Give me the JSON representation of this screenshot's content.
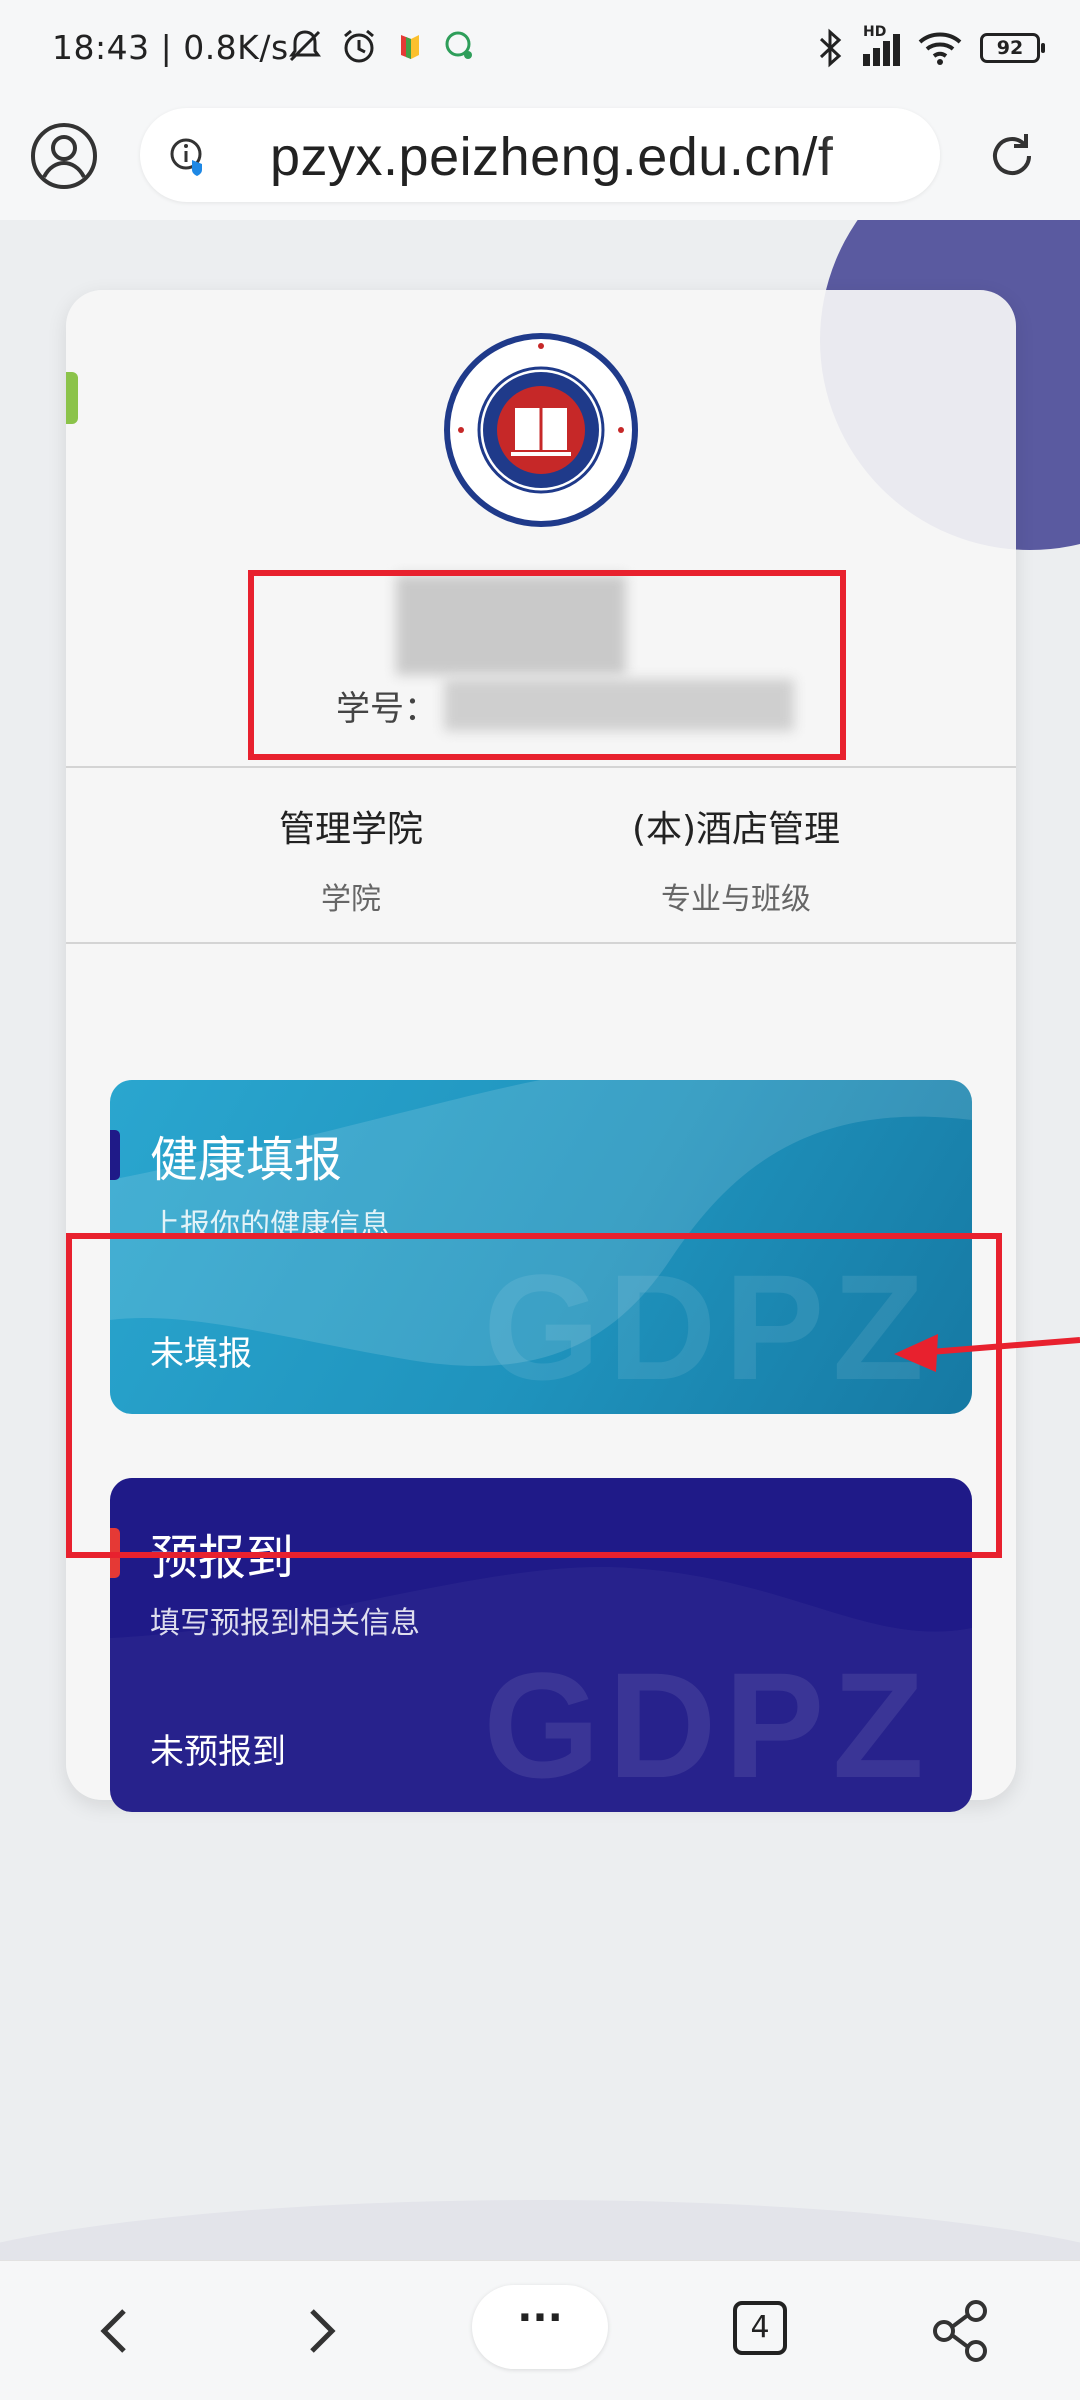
{
  "status_bar": {
    "time": "18:43 | 0.8K/s",
    "battery": "92",
    "signal_label": "HD"
  },
  "browser": {
    "url": "pzyx.peizheng.edu.cn/f"
  },
  "profile": {
    "student_id_label": "学号：",
    "college_value": "管理学院",
    "college_label": "学院",
    "major_value": "(本)酒店管理",
    "major_label": "专业与班级"
  },
  "cards": [
    {
      "title": "健康填报",
      "subtitle": "上报你的健康信息",
      "status": "未填报",
      "watermark": "GDPZ",
      "color": "#2aa6cf"
    },
    {
      "title": "预报到",
      "subtitle": "填写预报到相关信息",
      "status": "未预报到",
      "watermark": "GDPZ",
      "color": "#1f1a88"
    }
  ],
  "bottom_nav": {
    "more_label": "···",
    "tab_count": "4"
  },
  "colors": {
    "annotation_red": "#e8212e",
    "deco_purple": "#5a5aa0",
    "health_card_blue": "#2aa6cf",
    "prereg_card_navy": "#1f1a88"
  }
}
